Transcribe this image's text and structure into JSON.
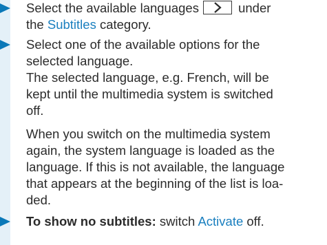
{
  "colors": {
    "band": "#e4f0f8",
    "arrow": "#0a78b8",
    "link": "#1a7fbf",
    "text": "#2b2b2b"
  },
  "steps": [
    {
      "line1_before": "Select the available languages",
      "key_icon": "chevron-right-icon",
      "line1_after": " under",
      "line2_before": "the ",
      "line2_link": "Subtitles",
      "line2_after": " category."
    },
    {
      "text": "Select one of the available options for the\nselected language.\nThe selected language, e.g. French, will be\nkept until the multimedia system is switched\noff."
    },
    {
      "note": "When you switch on the multimedia system\nagain, the system language is loaded as the\nlanguage. If this is not available, the language\nthat appears at the beginning of the list is loa-\nded."
    },
    {
      "bold": "To show no subtitles:",
      "after_bold": " switch ",
      "link": "Activate",
      "after_link": " off."
    }
  ]
}
